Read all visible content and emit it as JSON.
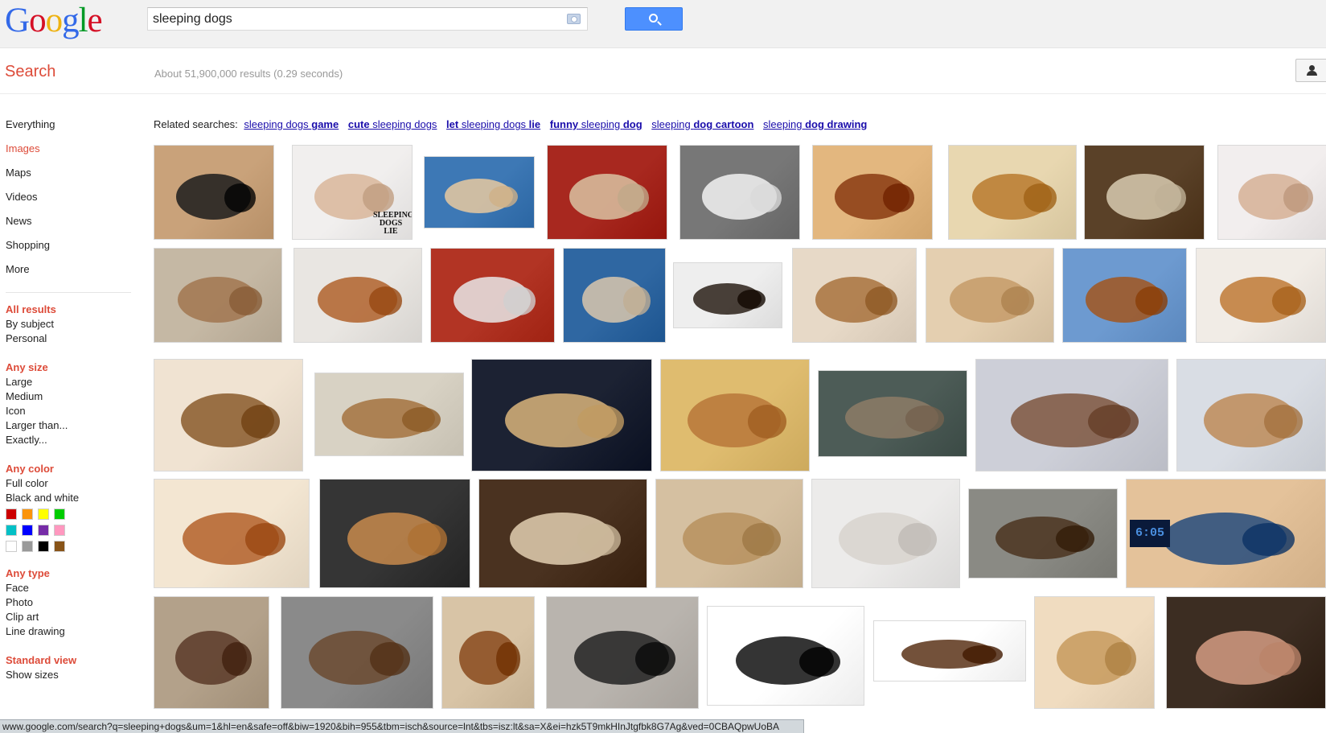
{
  "header": {
    "logo_letters": [
      "G",
      "o",
      "o",
      "g",
      "l",
      "e"
    ],
    "logo_colors": [
      "#3369e8",
      "#d50f25",
      "#eeb211",
      "#3369e8",
      "#009925",
      "#d50f25"
    ],
    "search_value": "sleeping dogs",
    "camera_icon": "camera-icon",
    "search_button_icon": "search-icon"
  },
  "subheader": {
    "title": "Search",
    "result_stats": "About 51,900,000 results (0.29 seconds)",
    "account_icon": "person-icon"
  },
  "sidebar": {
    "nav": [
      {
        "label": "Everything",
        "active": false
      },
      {
        "label": "Images",
        "active": true
      },
      {
        "label": "Maps",
        "active": false
      },
      {
        "label": "Videos",
        "active": false
      },
      {
        "label": "News",
        "active": false
      },
      {
        "label": "Shopping",
        "active": false
      },
      {
        "label": "More",
        "active": false
      }
    ],
    "results_group": {
      "title": "All results",
      "options": [
        "By subject",
        "Personal"
      ]
    },
    "size_group": {
      "title": "Any size",
      "options": [
        "Large",
        "Medium",
        "Icon",
        "Larger than...",
        "Exactly..."
      ]
    },
    "color_group": {
      "title": "Any color",
      "options": [
        "Full color",
        "Black and white"
      ],
      "swatches": [
        "#cc0000",
        "#fb940b",
        "#ffff00",
        "#00cc00",
        "#03c0c6",
        "#0000ff",
        "#762ca7",
        "#ff98bf",
        "#ffffff",
        "#999999",
        "#000000",
        "#885418"
      ]
    },
    "type_group": {
      "title": "Any type",
      "options": [
        "Face",
        "Photo",
        "Clip art",
        "Line drawing"
      ]
    },
    "view_group": {
      "title": "Standard view",
      "options": [
        "Show sizes"
      ]
    }
  },
  "related": {
    "label": "Related searches:",
    "links": [
      {
        "plain": "sleeping dogs ",
        "bold": "game"
      },
      {
        "bold": "cute",
        "plain": " sleeping dogs"
      },
      {
        "bold": "let",
        "plain": " sleeping dogs ",
        "bold2": "lie"
      },
      {
        "bold": "funny",
        "plain": " sleeping ",
        "bold2": "dog"
      },
      {
        "plain": "sleeping ",
        "bold": "dog cartoon"
      },
      {
        "plain": "sleeping ",
        "bold": "dog drawing"
      }
    ]
  },
  "thumb_texts": {
    "sleeping_dogs_lie": "SLEEPING DOGS LIE",
    "clock_display": "6:05"
  },
  "status_url": "www.google.com/search?q=sleeping+dogs&um=1&hl=en&safe=off&biw=1920&bih=955&tbm=isch&source=lnt&tbs=isz:lt&sa=X&ei=hzk5T9mkHInJtgfbk8G7Ag&ved=0CBAQpwUoBA"
}
